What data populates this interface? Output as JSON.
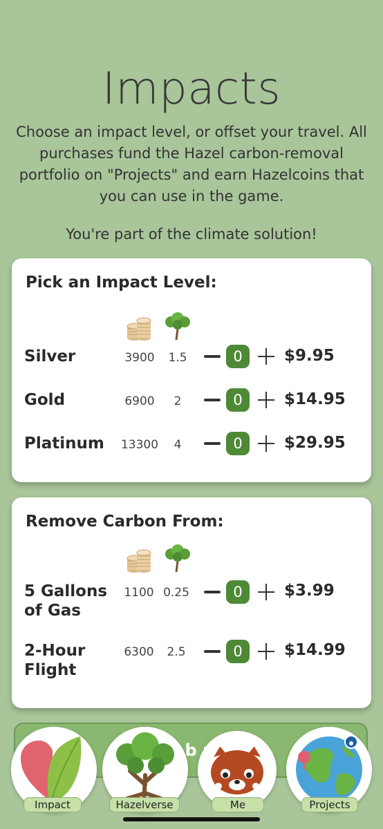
{
  "header": {
    "title": "Impacts",
    "description": "Choose an impact level, or offset your travel. All purchases fund the Hazel carbon-removal portfolio on \"Projects\" and earn Hazelcoins that you can use in the game.",
    "tagline": "You're part of the climate solution!"
  },
  "impact_card": {
    "title": "Pick an Impact Level:",
    "column_icons": [
      "coins-icon",
      "tree-icon"
    ],
    "rows": [
      {
        "name": "Silver",
        "coins": "3900",
        "co2": "1.5",
        "qty": "0",
        "price": "$9.95"
      },
      {
        "name": "Gold",
        "coins": "6900",
        "co2": "2",
        "qty": "0",
        "price": "$14.95"
      },
      {
        "name": "Platinum",
        "coins": "13300",
        "co2": "4",
        "qty": "0",
        "price": "$29.95"
      }
    ]
  },
  "carbon_card": {
    "title": "Remove Carbon From:",
    "column_icons": [
      "coins-icon",
      "tree-icon"
    ],
    "rows": [
      {
        "name_line1": "5 Gallons",
        "name_line2": "of Gas",
        "coins": "1100",
        "co2": "0.25",
        "qty": "0",
        "price": "$3.99"
      },
      {
        "name_line1": "2-Hour",
        "name_line2": "Flight",
        "coins": "6300",
        "co2": "2.5",
        "qty": "0",
        "price": "$14.99"
      }
    ]
  },
  "bottom_button": {
    "label": "op    b          no"
  },
  "nav": {
    "items": [
      {
        "label": "Impact",
        "icon": "heart-leaf-icon"
      },
      {
        "label": "Hazelverse",
        "icon": "tree-icon"
      },
      {
        "label": "Me",
        "icon": "red-panda-icon"
      },
      {
        "label": "Projects",
        "icon": "globe-icon"
      }
    ]
  },
  "colors": {
    "background": "#a9c59a",
    "qty_badge": "#4e8a36",
    "nav_label_bg": "#c6e0a8"
  }
}
